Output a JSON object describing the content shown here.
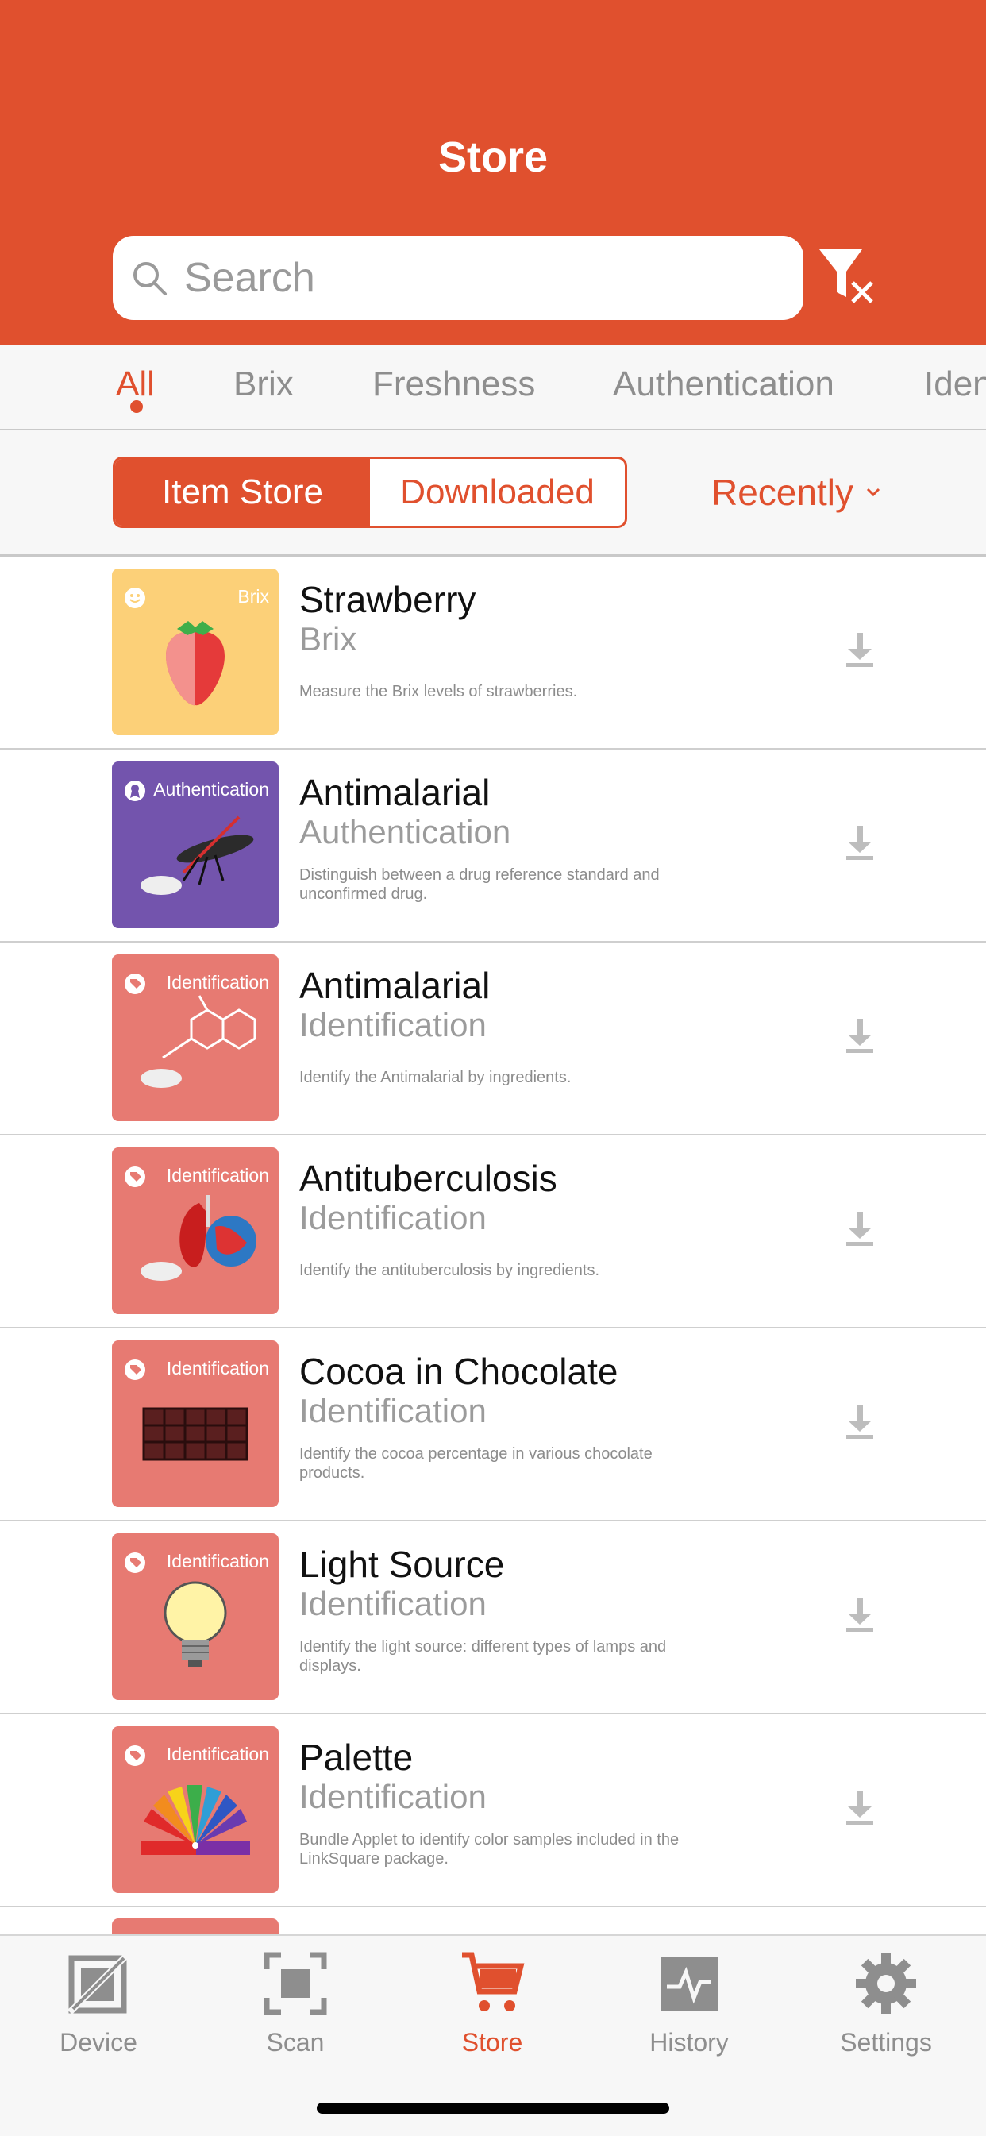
{
  "header": {
    "title": "Store"
  },
  "search": {
    "placeholder": "Search"
  },
  "tabs": [
    "All",
    "Brix",
    "Freshness",
    "Authentication",
    "Iden"
  ],
  "segments": {
    "item_store": "Item Store",
    "downloaded": "Downloaded"
  },
  "sort": {
    "label": "Recently"
  },
  "colors": {
    "accent": "#e0502e",
    "brix": "#fcd078",
    "authentication": "#7354ad",
    "identification": "#e77a72"
  },
  "items": [
    {
      "name": "Strawberry",
      "category": "Brix",
      "tag": "Brix",
      "description": "Measure the Brix levels of strawberries.",
      "icon": "strawberry-icon"
    },
    {
      "name": "Antimalarial",
      "category": "Authentication",
      "tag": "Authentication",
      "description": "Distinguish between a drug reference standard and unconfirmed drug.",
      "icon": "mosquito-icon"
    },
    {
      "name": "Antimalarial",
      "category": "Identification",
      "tag": "Identification",
      "description": "Identify the Antimalarial by ingredients.",
      "icon": "molecule-icon"
    },
    {
      "name": "Antituberculosis",
      "category": "Identification",
      "tag": "Identification",
      "description": "Identify the antituberculosis by ingredients.",
      "icon": "lungs-icon"
    },
    {
      "name": "Cocoa in Chocolate",
      "category": "Identification",
      "tag": "Identification",
      "description": "Identify the cocoa percentage in various chocolate products.",
      "icon": "chocolate-icon"
    },
    {
      "name": "Light Source",
      "category": "Identification",
      "tag": "Identification",
      "description": "Identify the light source: different types of lamps and displays.",
      "icon": "lightbulb-icon"
    },
    {
      "name": "Palette",
      "category": "Identification",
      "tag": "Identification",
      "description": "Bundle Applet to identify color samples included in the LinkSquare package.",
      "icon": "palette-icon"
    }
  ],
  "tabbar": [
    "Device",
    "Scan",
    "Store",
    "History",
    "Settings"
  ]
}
